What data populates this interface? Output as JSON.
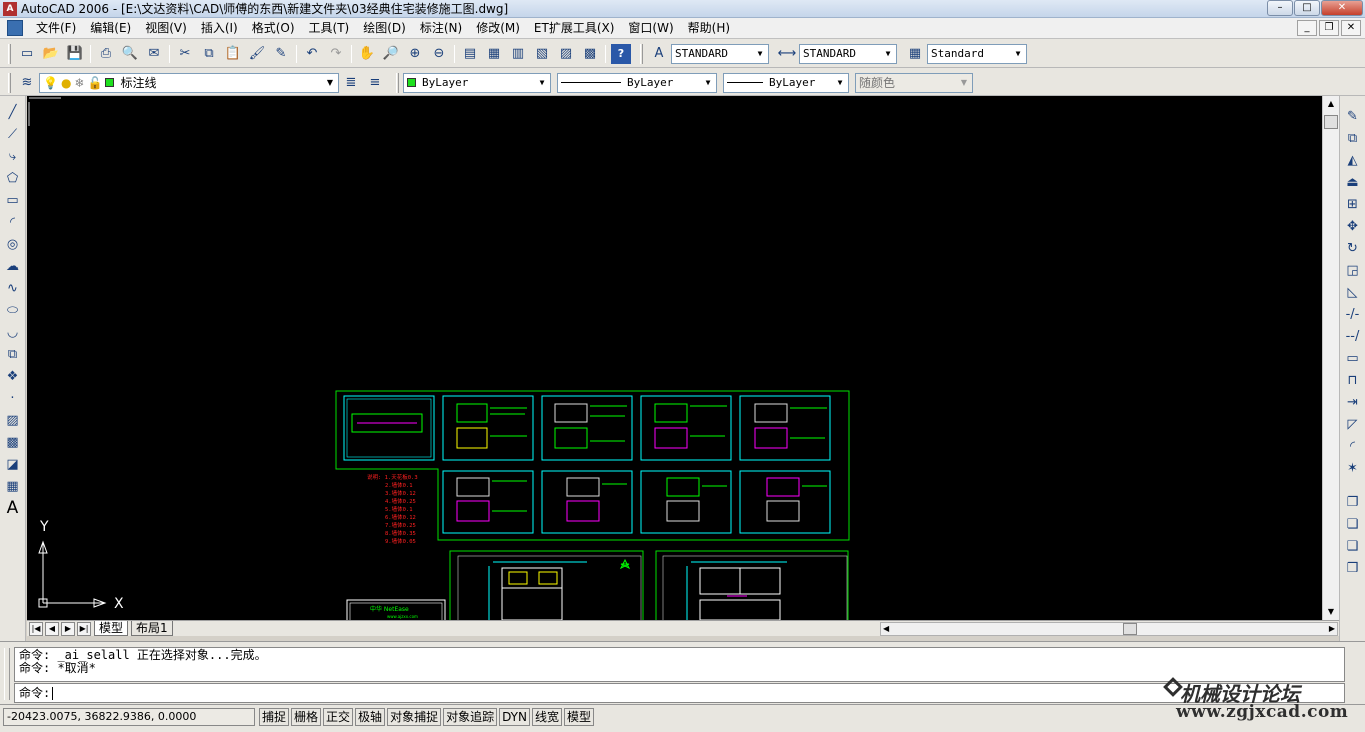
{
  "titlebar": {
    "title": "AutoCAD 2006 - [E:\\文达资料\\CAD\\师傅的东西\\新建文件夹\\03经典住宅装修施工图.dwg]"
  },
  "menu": [
    "文件(F)",
    "编辑(E)",
    "视图(V)",
    "插入(I)",
    "格式(O)",
    "工具(T)",
    "绘图(D)",
    "标注(N)",
    "修改(M)",
    "ET扩展工具(X)",
    "窗口(W)",
    "帮助(H)"
  ],
  "toolbar": {
    "text_style": "STANDARD",
    "dim_style": "STANDARD",
    "table_style": "Standard"
  },
  "layers": {
    "current_layer": "标注线",
    "color": "ByLayer",
    "linetype": "ByLayer",
    "lineweight": "ByLayer",
    "plotstyle": "随颜色",
    "layer_color_hex": "#1ee01e"
  },
  "ucs": {
    "x_label": "X",
    "y_label": "Y"
  },
  "tabs": {
    "model": "模型",
    "layout1": "布局1"
  },
  "command": {
    "history": [
      "命令: _ai_selall 正在选择对象...完成。",
      "命令: *取消*"
    ],
    "prompt": "命令:"
  },
  "status": {
    "coords": "-20423.0075, 36822.9386, 0.0000",
    "buttons": [
      "捕捉",
      "栅格",
      "正交",
      "极轴",
      "对象捕捉",
      "对象追踪",
      "DYN",
      "线宽",
      "模型"
    ]
  },
  "watermark": {
    "line1": "机械设计论坛",
    "line2": "www.zgjxcad.com"
  },
  "drawing": {
    "frame_color": "#00e000",
    "sheet_color": "#00ffff",
    "note_color": "#ff2020",
    "notes": [
      "说明: 1.天花板0.3",
      "2.墙体0.1",
      "3.墙体0.12",
      "4.墙体0.25",
      "5.墙体0.1",
      "6.墙体0.12",
      "7.墙体0.25",
      "8.墙体0.35",
      "9.墙体0.05",
      "10.墙体0.12"
    ],
    "title_block": "中华 NetEase",
    "title_block_sub": "www.ajzxx.com"
  }
}
